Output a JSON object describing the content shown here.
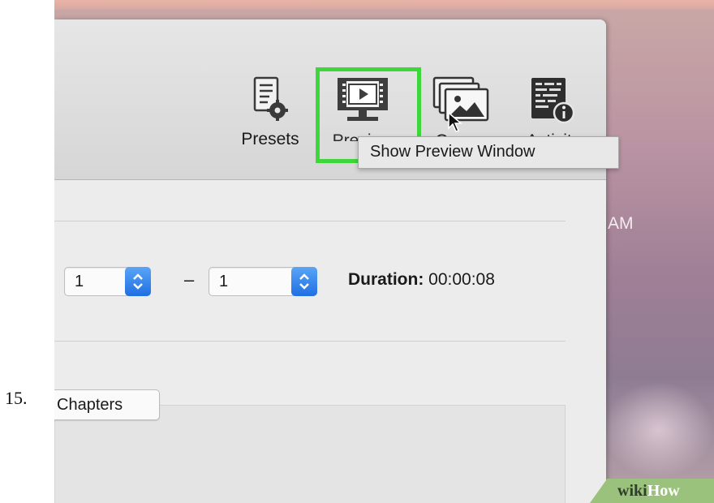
{
  "step": {
    "number": "15."
  },
  "toolbar": {
    "presets_label": "Presets",
    "preview_label": "Preview",
    "queue_label": "Queue",
    "activity_label": "Activity",
    "icons": {
      "presets": "presets-gear-icon",
      "preview": "preview-monitor-icon",
      "queue": "queue-images-icon",
      "activity": "activity-log-icon"
    }
  },
  "tooltip": {
    "text": "Show Preview Window"
  },
  "range": {
    "start_value": "1",
    "dash": "–",
    "end_value": "1",
    "duration_label": "Duration:",
    "duration_value": "00:00:08"
  },
  "tabs": {
    "chapters_label": "Chapters"
  },
  "desktop": {
    "time_fragment": "AM"
  },
  "watermark": {
    "wiki": "wiki",
    "how": "How"
  },
  "colors": {
    "highlight": "#3dd63b",
    "stepper_accent": "#2a7ff0",
    "watermark_bg": "#9bc27c"
  }
}
